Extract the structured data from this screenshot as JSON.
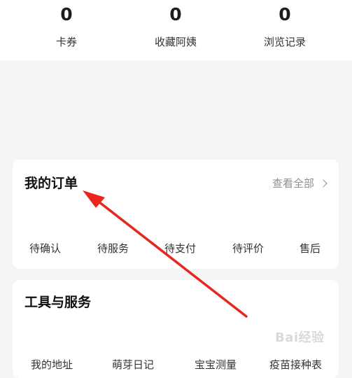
{
  "stats": [
    {
      "value": "0",
      "label": "卡券"
    },
    {
      "value": "0",
      "label": "收藏阿姨"
    },
    {
      "value": "0",
      "label": "浏览记录"
    }
  ],
  "orders": {
    "title": "我的订单",
    "view_all": "查看全部",
    "items": [
      "待确认",
      "待服务",
      "待支付",
      "待评价",
      "售后"
    ]
  },
  "tools": {
    "title": "工具与服务",
    "items": [
      "我的地址",
      "萌芽日记",
      "宝宝测量",
      "疫苗接种表"
    ]
  },
  "watermark": {
    "text": "Bai经验"
  },
  "colors": {
    "arrow": "#e8261f",
    "muted": "#8e8e93",
    "background": "#f5f5f6"
  }
}
